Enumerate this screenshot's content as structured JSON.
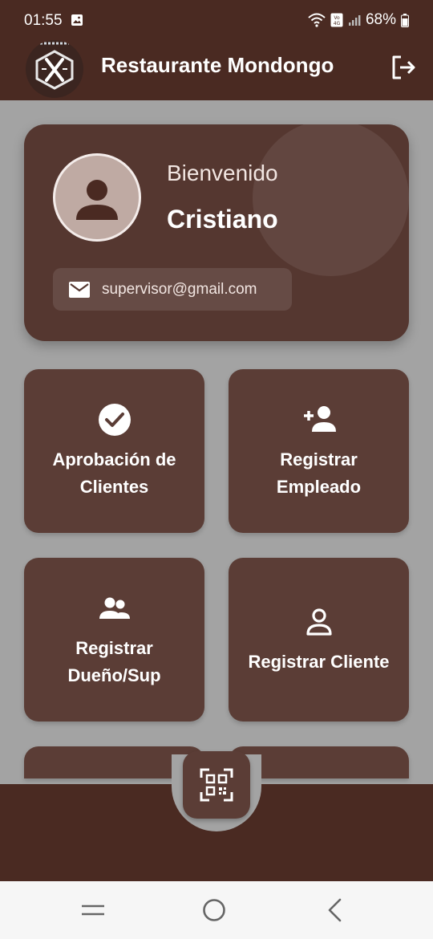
{
  "status_bar": {
    "time": "01:55",
    "battery": "68%",
    "icons": [
      "image-icon",
      "wifi-icon",
      "volte-icon",
      "signal-icon",
      "battery-icon"
    ]
  },
  "app_bar": {
    "title": "Restaurante Mondongo",
    "logo": "restaurant-logo",
    "action_icon": "logout-icon"
  },
  "profile": {
    "greeting": "Bienvenido",
    "name": "Cristiano",
    "email": "supervisor@gmail.com",
    "avatar_icon": "person-icon",
    "email_icon": "mail-icon"
  },
  "tiles": [
    {
      "label_line1": "Aprobación de",
      "label_line2": "Clientes",
      "icon": "check-circle-icon"
    },
    {
      "label_line1": "Registrar",
      "label_line2": "Empleado",
      "icon": "person-add-icon"
    },
    {
      "label_line1": "Registrar",
      "label_line2": "Dueño/Sup",
      "icon": "group-icon"
    },
    {
      "label_line1": "Registrar Cliente",
      "label_line2": "",
      "icon": "person-outline-icon"
    }
  ],
  "bottom": {
    "fab_icon": "qr-code-icon"
  },
  "colors": {
    "primary_dark": "#4a2a22",
    "card": "#553730",
    "tile": "#5b3d36",
    "background": "#a3a3a3"
  }
}
